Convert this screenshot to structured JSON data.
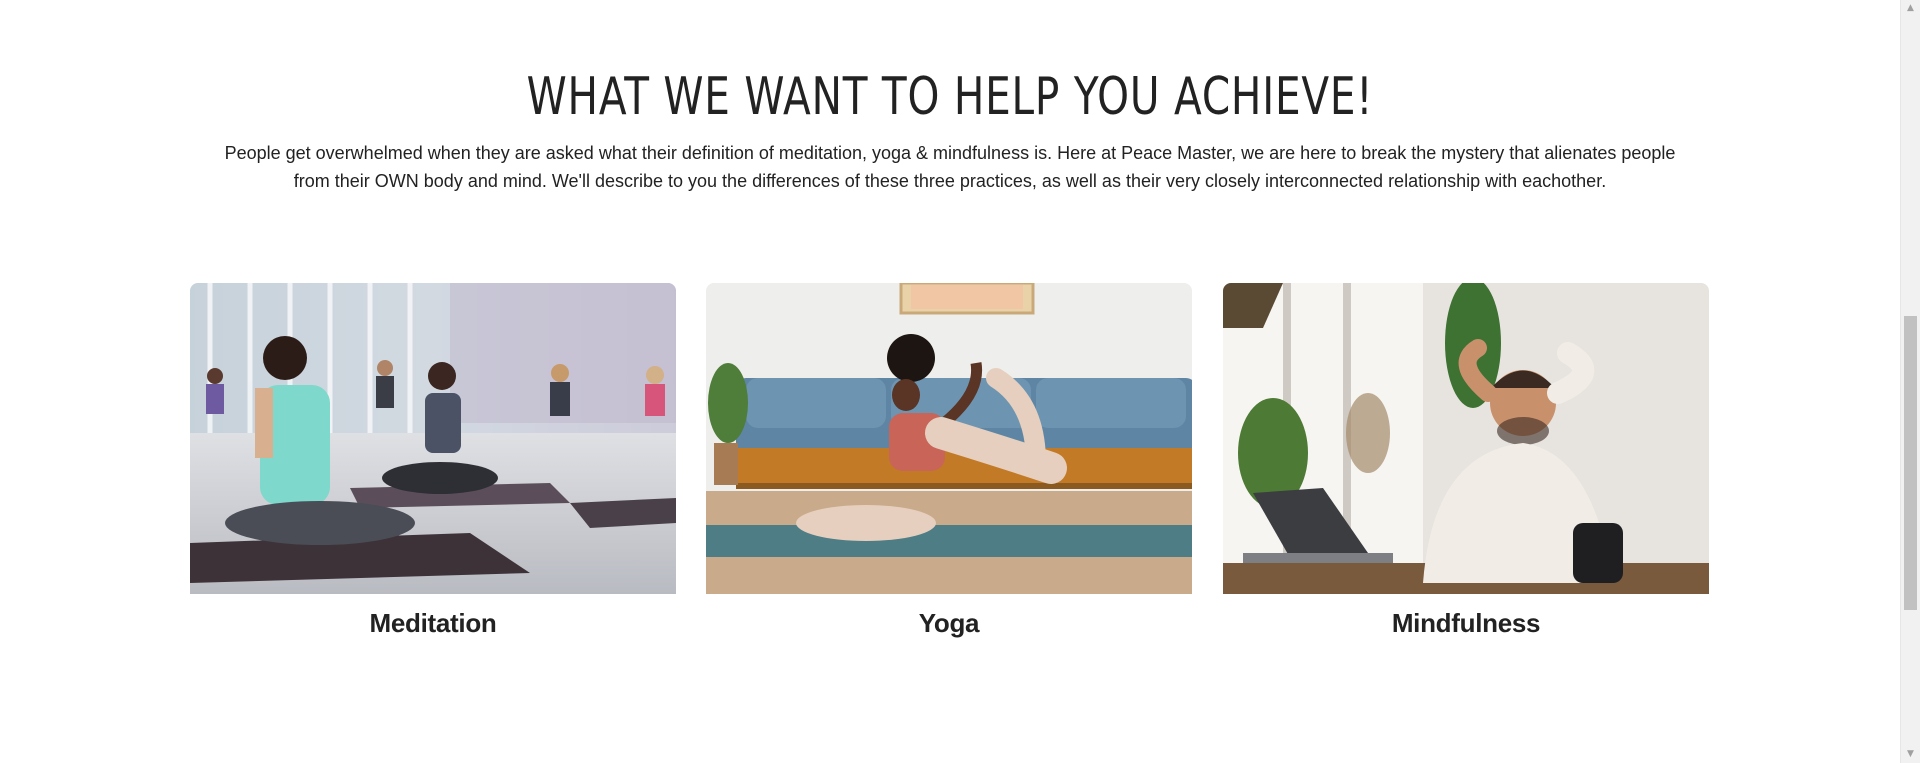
{
  "section": {
    "title": "WHAT WE WANT TO HELP YOU ACHIEVE!",
    "description": "People get overwhelmed when they are asked what their definition of meditation, yoga & mindfulness is. Here at Peace Master, we are here to break the mystery that alienates people from their OWN body and mind. We'll describe to you the differences of these three practices, as well as their very closely interconnected relationship with eachother."
  },
  "cards": [
    {
      "title": "Meditation",
      "image": "group-meditation-class-photo"
    },
    {
      "title": "Yoga",
      "image": "woman-yoga-pose-photo"
    },
    {
      "title": "Mindfulness",
      "image": "relaxed-man-at-desk-photo"
    }
  ],
  "scrollbar": {
    "up_icon": "arrow-up-icon",
    "down_icon": "arrow-down-icon"
  }
}
